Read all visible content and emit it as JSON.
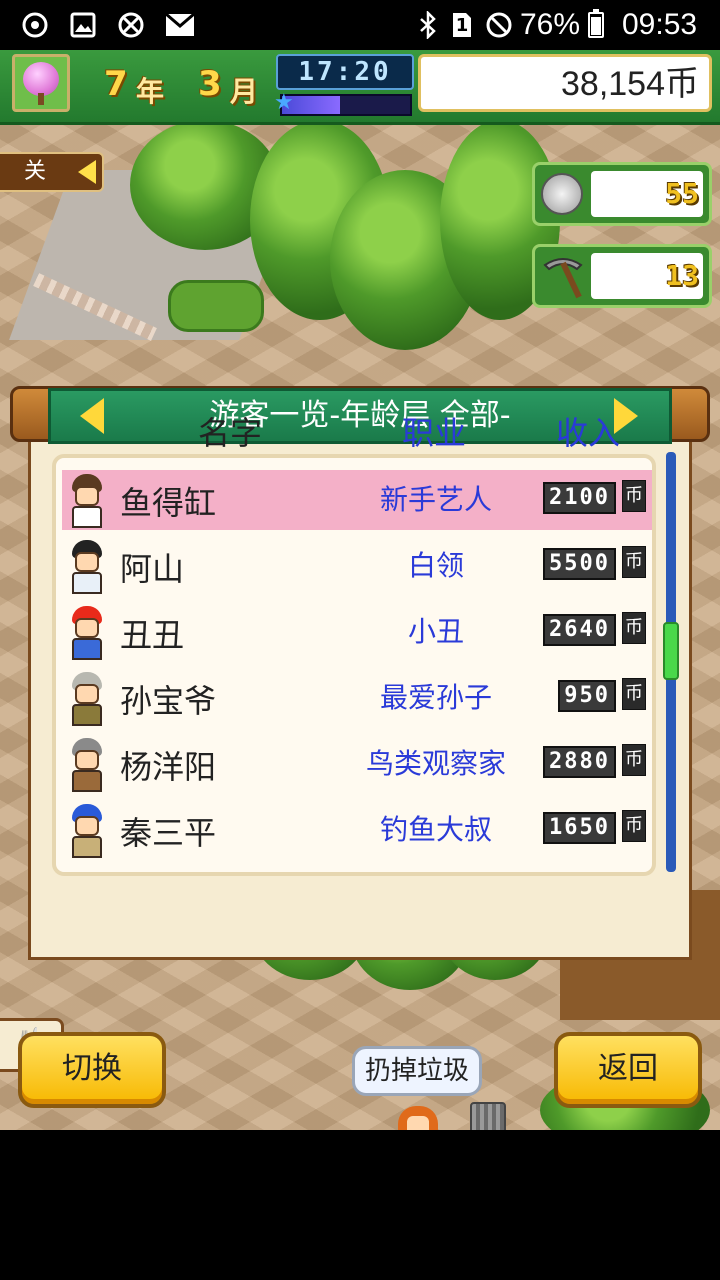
{
  "status_bar": {
    "battery": "76%",
    "time": "09:53",
    "sim_label": "1"
  },
  "hud": {
    "year": "7",
    "year_unit": "年",
    "month": "3",
    "month_unit": "月",
    "clock": "17:20",
    "day_progress": 0.45,
    "money": "38,154币"
  },
  "side_tab": {
    "label": "关"
  },
  "resources": {
    "medals": "55",
    "pickaxes": "13"
  },
  "dialog": {
    "title": "游客一览-年龄层 全部-",
    "columns": {
      "name": "名字",
      "job": "职业",
      "income": "收入"
    },
    "currency": "币",
    "scroll_position": 0.35,
    "rows": [
      {
        "name": "鱼得缸",
        "job": "新手艺人",
        "income": "2100",
        "selected": true,
        "hair": "#5a3a20",
        "shirt": "#ffffff"
      },
      {
        "name": "阿山",
        "job": "白领",
        "income": "5500",
        "selected": false,
        "hair": "#222222",
        "shirt": "#e8f0f8"
      },
      {
        "name": "丑丑",
        "job": "小丑",
        "income": "2640",
        "selected": false,
        "hair": "#e82a1a",
        "shirt": "#3a6ad8"
      },
      {
        "name": "孙宝爷",
        "job": "最爱孙子",
        "income": "950",
        "selected": false,
        "hair": "#b8b8b0",
        "shirt": "#8a7a3a"
      },
      {
        "name": "杨洋阳",
        "job": "鸟类观察家",
        "income": "2880",
        "selected": false,
        "hair": "#8a8a8a",
        "shirt": "#9a6a3a"
      },
      {
        "name": "秦三平",
        "job": "钓鱼大叔",
        "income": "1650",
        "selected": false,
        "hair": "#2a5ad8",
        "shirt": "#c8b078"
      }
    ]
  },
  "buttons": {
    "switch": "切换",
    "back": "返回",
    "throw_trash": "扔掉垃圾"
  }
}
